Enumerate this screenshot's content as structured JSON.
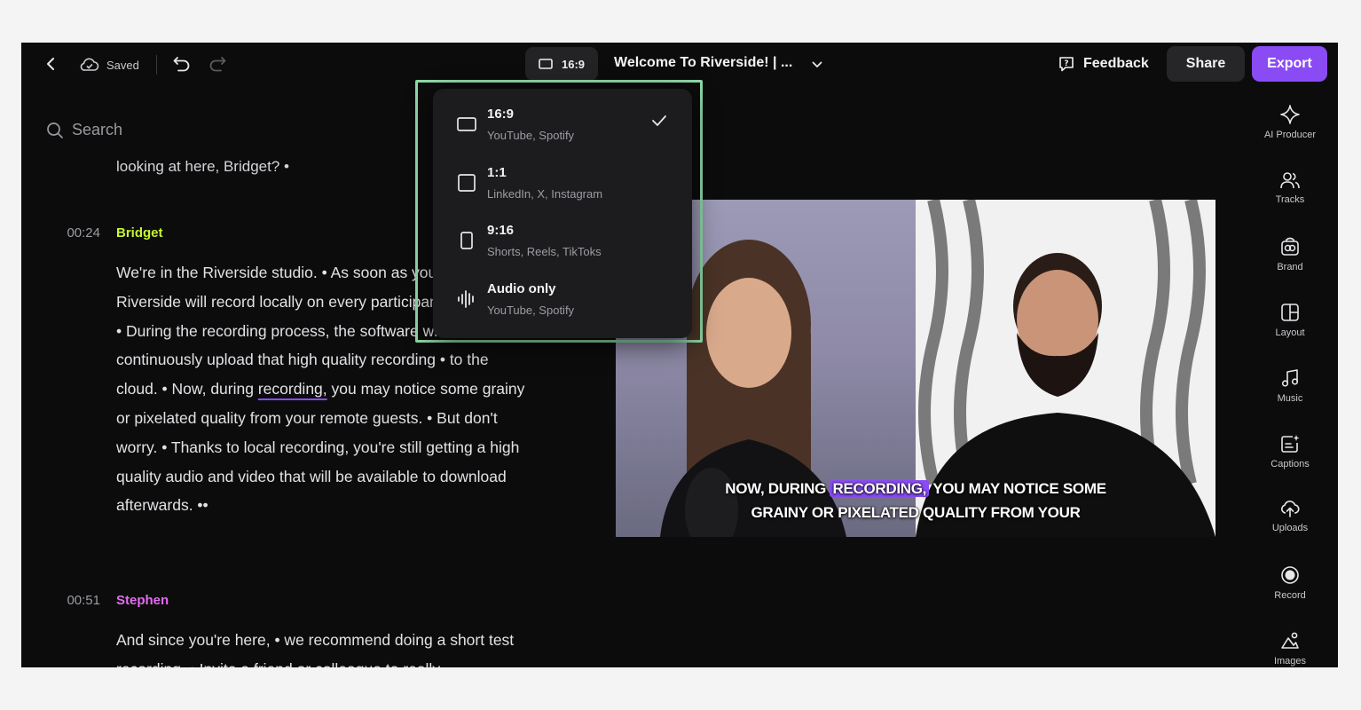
{
  "toolbar": {
    "saved_label": "Saved",
    "aspect_ratio_label": "16:9",
    "project_title": "Welcome To Riverside! | ...",
    "feedback_label": "Feedback",
    "share_label": "Share",
    "export_label": "Export"
  },
  "search": {
    "placeholder": "Search"
  },
  "transcript": {
    "cut_line": "looking at here, Bridget? •",
    "segments": [
      {
        "time": "00:24",
        "speaker": "Bridget",
        "speaker_color": "#c6f432",
        "text_before": "We're in the Riverside studio. • As soon as you hit record, Riverside will record locally on every participant's computer. • During the recording process, the software will continuously upload that high quality recording • to the cloud. • Now, during ",
        "highlight": "recording,",
        "text_after": " you may notice some grainy or pixelated quality from your remote guests. • But don't worry. • Thanks to local recording, you're still getting a high quality audio and video that will be available to download afterwards. ••"
      },
      {
        "time": "00:51",
        "speaker": "Stephen",
        "speaker_color": "#e56bf0",
        "text": "And since you're here, • we recommend doing a short test recording. • Invite a friend or colleague to really"
      }
    ]
  },
  "video": {
    "caption_line1_before": "NOW, DURING ",
    "caption_highlight": "RECORDING,",
    "caption_line1_after": " YOU MAY NOTICE SOME",
    "caption_line2": "GRAINY OR PIXELATED QUALITY FROM YOUR"
  },
  "aspect_menu": {
    "items": [
      {
        "label": "16:9",
        "sub": "YouTube, Spotify",
        "icon": "landscape-icon",
        "selected": true
      },
      {
        "label": "1:1",
        "sub": "LinkedIn, X, Instagram",
        "icon": "square-icon",
        "selected": false
      },
      {
        "label": "9:16",
        "sub": "Shorts, Reels, TikToks",
        "icon": "portrait-icon",
        "selected": false
      },
      {
        "label": "Audio only",
        "sub": "YouTube, Spotify",
        "icon": "waveform-icon",
        "selected": false
      }
    ]
  },
  "rail": {
    "items": [
      {
        "label": "AI Producer",
        "icon": "sparkle-icon"
      },
      {
        "label": "Tracks",
        "icon": "users-icon"
      },
      {
        "label": "Brand",
        "icon": "brand-icon"
      },
      {
        "label": "Layout",
        "icon": "layout-icon"
      },
      {
        "label": "Music",
        "icon": "music-icon"
      },
      {
        "label": "Captions",
        "icon": "captions-icon"
      },
      {
        "label": "Uploads",
        "icon": "upload-icon"
      },
      {
        "label": "Record",
        "icon": "record-icon"
      },
      {
        "label": "Images",
        "icon": "images-icon"
      }
    ]
  },
  "colors": {
    "accent": "#8a4bf5",
    "menu_outline": "#8ed9a8",
    "background": "#0c0c0d"
  }
}
